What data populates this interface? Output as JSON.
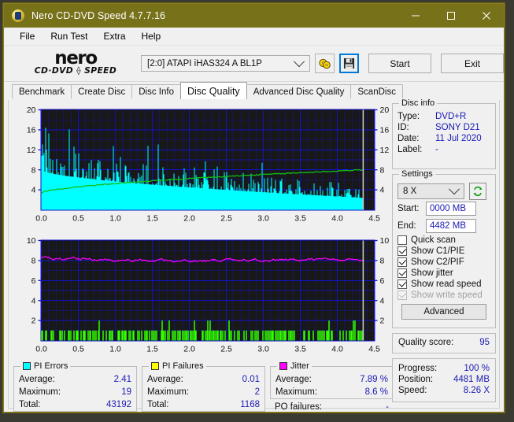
{
  "window": {
    "title": "Nero CD-DVD Speed 4.7.7.16",
    "minimize": "─",
    "maximize": "□",
    "close": "✕"
  },
  "menu": [
    "File",
    "Run Test",
    "Extra",
    "Help"
  ],
  "logo": {
    "line1": "nero",
    "line2": "CD·DVD ⟠ SPEED"
  },
  "toolbar": {
    "drive": "[2:0]   ATAPI iHAS324   A BL1P",
    "disc_icon": "disc-speed-icon",
    "save_icon": "save-floppy-icon",
    "start_label": "Start",
    "exit_label": "Exit"
  },
  "tabs": [
    {
      "label": "Benchmark",
      "active": false
    },
    {
      "label": "Create Disc",
      "active": false
    },
    {
      "label": "Disc Info",
      "active": false
    },
    {
      "label": "Disc Quality",
      "active": true
    },
    {
      "label": "Advanced Disc Quality",
      "active": false
    },
    {
      "label": "ScanDisc",
      "active": false
    }
  ],
  "disc_info": {
    "title": "Disc info",
    "type_label": "Type:",
    "type_value": "DVD+R",
    "id_label": "ID:",
    "id_value": "SONY D21",
    "date_label": "Date:",
    "date_value": "11 Jul 2020",
    "label_label": "Label:",
    "label_value": "-"
  },
  "settings": {
    "title": "Settings",
    "speed": "8 X",
    "refresh_icon": "refresh-icon",
    "start_label": "Start:",
    "start_value": "0000 MB",
    "end_label": "End:",
    "end_value": "4482 MB",
    "checks": [
      {
        "label": "Quick scan",
        "checked": false,
        "disabled": false
      },
      {
        "label": "Show C1/PIE",
        "checked": true,
        "disabled": false
      },
      {
        "label": "Show C2/PIF",
        "checked": true,
        "disabled": false
      },
      {
        "label": "Show jitter",
        "checked": true,
        "disabled": false
      },
      {
        "label": "Show read speed",
        "checked": true,
        "disabled": false
      },
      {
        "label": "Show write speed",
        "checked": true,
        "disabled": true
      }
    ],
    "advanced_label": "Advanced"
  },
  "quality": {
    "label": "Quality score:",
    "value": "95"
  },
  "progress": {
    "progress_label": "Progress:",
    "progress_value": "100 %",
    "position_label": "Position:",
    "position_value": "4481 MB",
    "speed_label": "Speed:",
    "speed_value": "8.26 X"
  },
  "stats": {
    "pi_errors": {
      "title": "PI Errors",
      "color": "#00ffff",
      "rows": [
        {
          "k": "Average:",
          "v": "2.41"
        },
        {
          "k": "Maximum:",
          "v": "19"
        },
        {
          "k": "Total:",
          "v": "43192"
        }
      ]
    },
    "pi_failures": {
      "title": "PI Failures",
      "color": "#ffff00",
      "rows": [
        {
          "k": "Average:",
          "v": "0.01"
        },
        {
          "k": "Maximum:",
          "v": "2"
        },
        {
          "k": "Total:",
          "v": "1168"
        }
      ]
    },
    "jitter": {
      "title": "Jitter",
      "color": "#ff00ff",
      "rows": [
        {
          "k": "Average:",
          "v": "7.89 %"
        },
        {
          "k": "Maximum:",
          "v": "8.6 %"
        }
      ],
      "po_label": "PO failures:",
      "po_value": "-"
    }
  },
  "chart_data": [
    {
      "type": "area",
      "name": "PI Errors / read speed",
      "title": "",
      "xlabel": "",
      "ylabel": "",
      "xlim": [
        0.0,
        4.5
      ],
      "ylim": [
        0,
        20
      ],
      "xticks": [
        "0.0",
        "0.5",
        "1.0",
        "1.5",
        "2.0",
        "2.5",
        "3.0",
        "3.5",
        "4.0",
        "4.5"
      ],
      "yticks": [
        "4",
        "8",
        "12",
        "16",
        "20"
      ],
      "grid": true,
      "background": "#181818",
      "series": [
        {
          "name": "PI Errors",
          "kind": "spikes",
          "color": "#00ffff",
          "baseline_start": 8.0,
          "baseline_end": 3.0,
          "noise_amp_start": 6.0,
          "noise_amp_end": 2.0,
          "max": 19,
          "average": 2.41,
          "data_end_x": 4.35,
          "note": "dense vertical spikes, envelope decays from ~16 at 0.0 to ~6 by 4.3, a few peaks to 19 near 0.3"
        },
        {
          "name": "Read speed",
          "kind": "line",
          "color": "#00c000",
          "y_start": 3.4,
          "y_end": 8.0,
          "data_end_x": 4.35,
          "note": "gradually rising CAV read-speed curve from ~3.4 to ~8.0 on the 0-20 scale"
        }
      ],
      "cursor_x": 4.35,
      "cursor_color": "#c8c8c8"
    },
    {
      "type": "area",
      "name": "PI Failures / jitter",
      "title": "",
      "xlabel": "",
      "ylabel": "",
      "xlim": [
        0.0,
        4.5
      ],
      "ylim": [
        0,
        10
      ],
      "xticks": [
        "0.0",
        "0.5",
        "1.0",
        "1.5",
        "2.0",
        "2.5",
        "3.0",
        "3.5",
        "4.0",
        "4.5"
      ],
      "yticks": [
        "2",
        "4",
        "6",
        "8",
        "10"
      ],
      "grid": true,
      "background": "#181818",
      "series": [
        {
          "name": "PI Failures",
          "kind": "spikes",
          "color": "#33ff00",
          "baseline": 0,
          "typical_max": 1,
          "max": 2,
          "average": 0.01,
          "data_end_x": 4.35,
          "note": "sparse green bars of height 1-2 along the bottom"
        },
        {
          "name": "Jitter",
          "kind": "line",
          "color": "#ff00ff",
          "y_start": 8.3,
          "y_mean": 7.9,
          "y_end": 8.0,
          "min": 7.5,
          "max": 8.6,
          "data_end_x": 4.35,
          "note": "noisy magenta line hovering just under 8"
        }
      ],
      "cursor_x": 4.35,
      "cursor_color": "#c8c8c8"
    }
  ]
}
